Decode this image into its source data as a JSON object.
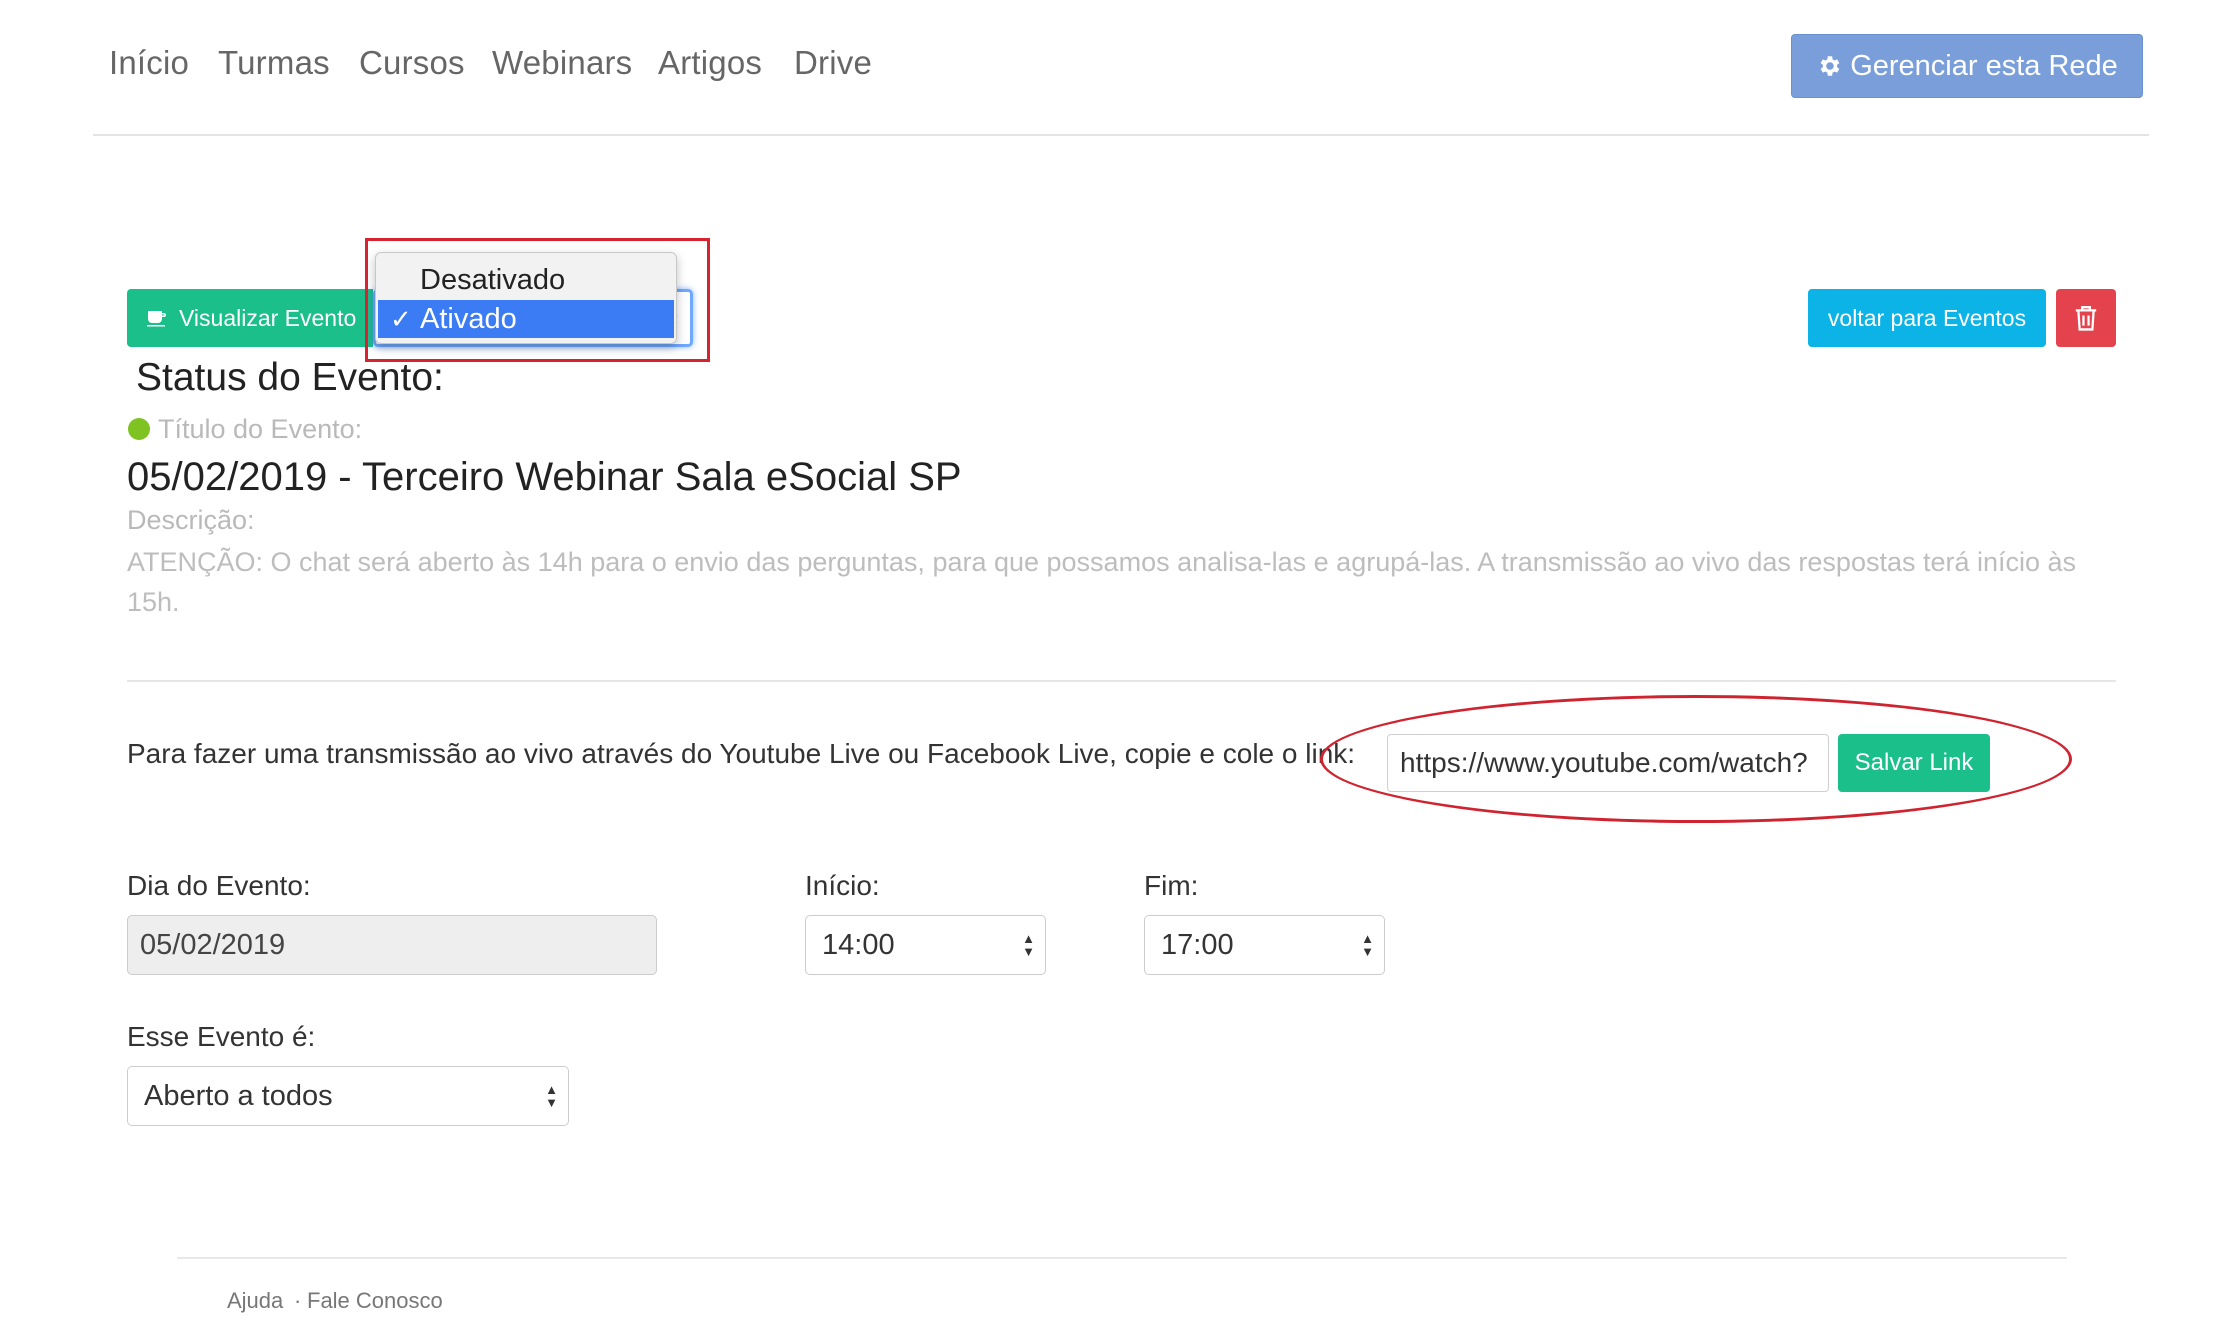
{
  "nav": {
    "items": [
      "Início",
      "Turmas",
      "Cursos",
      "Webinars",
      "Artigos",
      "Drive"
    ],
    "manage_label": "Gerenciar esta Rede"
  },
  "toolbar": {
    "view_label": "Visualizar Evento",
    "status_options": [
      "Desativado",
      "Ativado"
    ],
    "status_selected": "Ativado",
    "back_label": "voltar para Eventos"
  },
  "event": {
    "status_heading": "Status do Evento:",
    "title_label": "Título do Evento:",
    "title": "05/02/2019 - Terceiro Webinar Sala eSocial SP",
    "description_label": "Descrição:",
    "description": "ATENÇÃO: O chat será aberto às 14h para o envio das perguntas, para que possamos analisa-las e agrupá-las. A transmissão ao vivo das respostas terá início às 15h.",
    "status_color": "#7ec322"
  },
  "live": {
    "instruction": "Para fazer uma transmissão ao vivo através do Youtube Live ou Facebook Live, copie e cole o link:",
    "link_value": "https://www.youtube.com/watch?",
    "save_label": "Salvar Link"
  },
  "form": {
    "day_label": "Dia do Evento:",
    "day_value": "05/02/2019",
    "start_label": "Início:",
    "start_value": "14:00",
    "end_label": "Fim:",
    "end_value": "17:00",
    "access_label": "Esse Evento é:",
    "access_value": "Aberto a todos"
  },
  "footer": {
    "help": "Ajuda",
    "contact": "Fale Conosco"
  },
  "colors": {
    "green": "#1bbf8a",
    "blue": "#0bb3e6",
    "red": "#e4424c",
    "manage_blue": "#7a9ed9",
    "annotation_red": "#cf2430"
  }
}
